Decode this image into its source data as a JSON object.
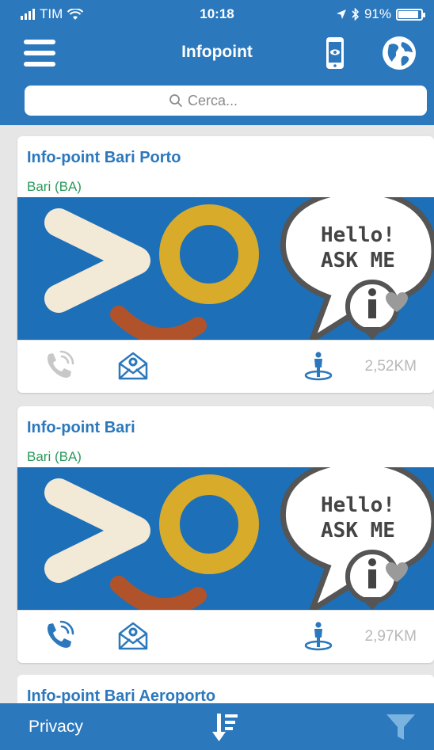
{
  "status_bar": {
    "carrier": "TIM",
    "time": "10:18",
    "battery": "91%",
    "battery_level": 0.91
  },
  "header": {
    "title": "Infopoint",
    "background_color": "#2b78bd",
    "icons": [
      "menu-icon",
      "smartphone-eye-icon",
      "globe-icon"
    ]
  },
  "search": {
    "placeholder": "Cerca..."
  },
  "cards": [
    {
      "title": "Info-point Bari Porto",
      "city": "Bari (BA)",
      "banner_text_1": "Hello!",
      "banner_text_2": "ASK ME",
      "phone_enabled": false,
      "distance": "2,52KM"
    },
    {
      "title": "Info-point Bari",
      "city": "Bari (BA)",
      "banner_text_1": "Hello!",
      "banner_text_2": "ASK ME",
      "phone_enabled": true,
      "distance": "2,97KM"
    },
    {
      "title": "Info-point Bari Aeroporto"
    }
  ],
  "bottom_bar": {
    "privacy": "Privacy",
    "icons": [
      "sort-icon",
      "filter-icon"
    ]
  },
  "colors": {
    "accent": "#2b78bd",
    "city_text": "#2a9a5a",
    "banner_blue": "#1d6fb8",
    "banner_cream": "#f2ead6",
    "banner_gold": "#d9ab2b",
    "banner_rust": "#b0532a",
    "muted": "#b8b8b8"
  }
}
